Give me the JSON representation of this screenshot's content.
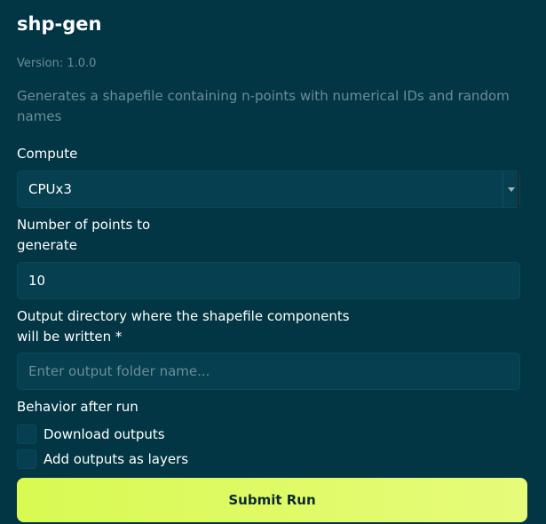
{
  "app": {
    "title": "shp-gen",
    "version": "Version: 1.0.0",
    "description": "Generates a shapefile containing n-points with numerical IDs and random names"
  },
  "compute": {
    "label": "Compute",
    "selected": "CPUx3"
  },
  "points": {
    "label_line1": "Number of points to",
    "label_line2": "generate",
    "value": "10"
  },
  "output_dir": {
    "label_line1": "Output directory where the shapefile components",
    "label_line2": "will be written *",
    "placeholder": "Enter output folder name..."
  },
  "behavior": {
    "label": "Behavior after run",
    "options": [
      {
        "label": "Download outputs",
        "checked": false
      },
      {
        "label": "Add outputs as layers",
        "checked": false
      }
    ]
  },
  "submit": {
    "label": "Submit Run"
  },
  "colors": {
    "background": "#023644",
    "field": "#063f4f",
    "muted_text": "#6d8d95",
    "accent": "#d8fa52"
  }
}
